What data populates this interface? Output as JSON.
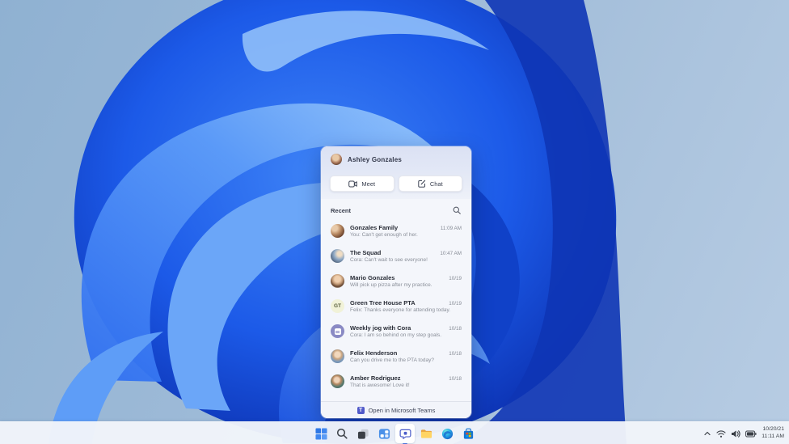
{
  "wallpaper": {
    "name": "Windows 11 Bloom",
    "colors": {
      "sky": "#9fbbd8",
      "bloom_bright": "#2e71f0",
      "bloom_dark": "#0b34b2",
      "bloom_light": "#8fc0fb"
    }
  },
  "chat_flyout": {
    "header": {
      "user_name": "Ashley Gonzales"
    },
    "actions": {
      "meet_label": "Meet",
      "chat_label": "Chat"
    },
    "recent_label": "Recent",
    "items": [
      {
        "name": "Gonzales Family",
        "preview": "You: Can't get enough of her.",
        "time": "11:09 AM",
        "avatar_type": "photo"
      },
      {
        "name": "The Squad",
        "preview": "Cora: Can't wait to see everyone!",
        "time": "10:47 AM",
        "avatar_type": "photo"
      },
      {
        "name": "Mario Gonzales",
        "preview": "Will pick up pizza after my practice.",
        "time": "10/19",
        "avatar_type": "photo"
      },
      {
        "name": "Green Tree House PTA",
        "preview": "Felix: Thanks everyone for attending today.",
        "time": "10/19",
        "avatar_type": "initials",
        "initials": "GT"
      },
      {
        "name": "Weekly jog with Cora",
        "preview": "Cora: I am so behind on my step goals.",
        "time": "10/18",
        "avatar_type": "app-icon"
      },
      {
        "name": "Felix Henderson",
        "preview": "Can you drive me to the PTA today?",
        "time": "10/18",
        "avatar_type": "photo"
      },
      {
        "name": "Amber Rodriguez",
        "preview": "That is awesome! Love it!",
        "time": "10/18",
        "avatar_type": "photo"
      }
    ],
    "footer": {
      "label": "Open in Microsoft Teams"
    },
    "accent_color": "#5059c9"
  },
  "taskbar": {
    "icons": [
      "start",
      "search",
      "task-view",
      "widgets",
      "chat",
      "file-explorer",
      "edge",
      "microsoft-store"
    ],
    "active_icon": "chat",
    "tray_icons": [
      "chevron-up",
      "wifi",
      "volume",
      "battery"
    ],
    "clock": {
      "date": "10/20/21",
      "time": "11:11 AM"
    }
  }
}
